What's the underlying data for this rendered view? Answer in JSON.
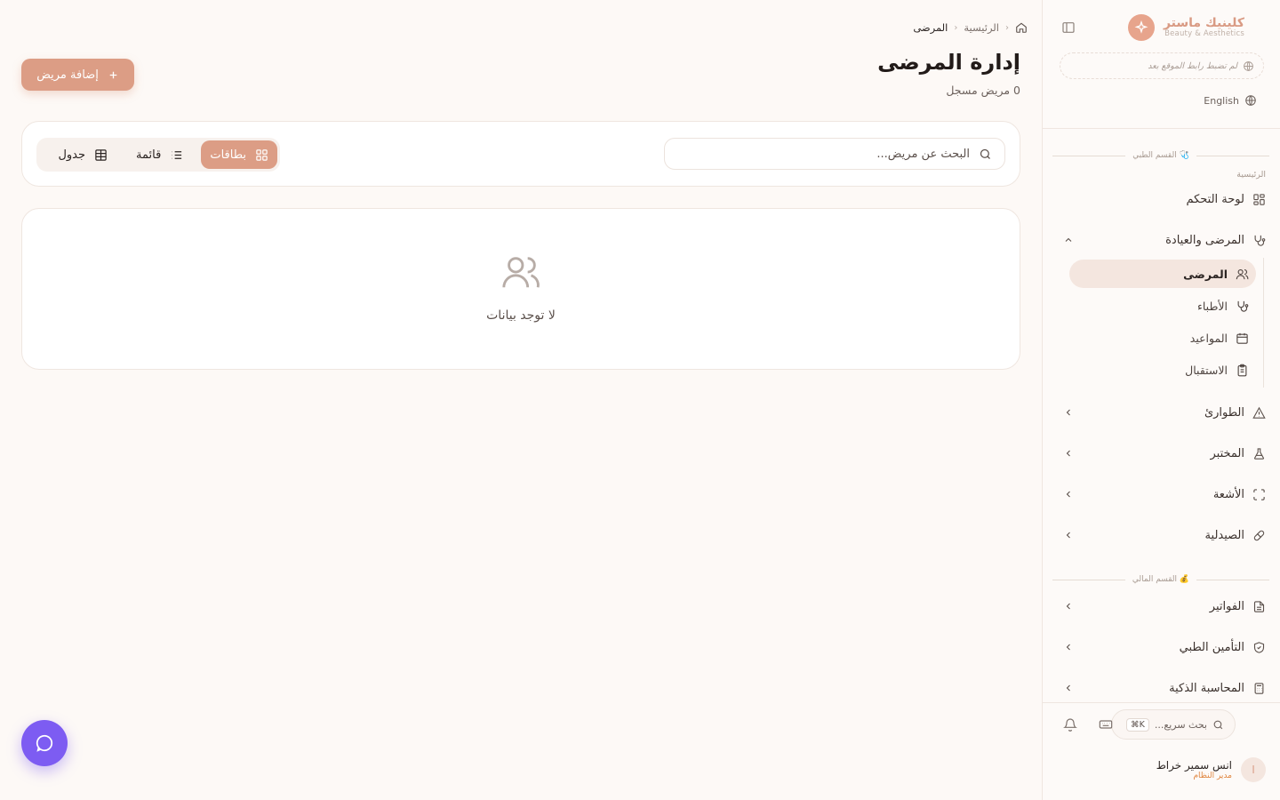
{
  "brand": {
    "name": "كلينيك ماستر",
    "subtitle": "Beauty & Aesthetics",
    "logo_icon": "sparkle-icon"
  },
  "sidebar": {
    "site_link_text": "لم تضبط رابط الموقع بعد",
    "language_label": "English",
    "medical_section_title": "🩺 القسم الطبي",
    "home_caption": "الرئيسية",
    "dashboard_label": "لوحة التحكم",
    "patients_group_label": "المرضى والعيادة",
    "sub_items": [
      {
        "label": "المرضى",
        "icon": "users-icon",
        "active": true
      },
      {
        "label": "الأطباء",
        "icon": "stethoscope-icon"
      },
      {
        "label": "المواعيد",
        "icon": "calendar-icon"
      },
      {
        "label": "الاستقبال",
        "icon": "clipboard-icon"
      }
    ],
    "groups": [
      {
        "label": "الطوارئ",
        "icon": "alert-triangle-icon"
      },
      {
        "label": "المختبر",
        "icon": "flask-icon"
      },
      {
        "label": "الأشعة",
        "icon": "scan-icon"
      },
      {
        "label": "الصيدلية",
        "icon": "pill-icon"
      }
    ],
    "finance_section_title": "💰 القسم المالي",
    "finance_groups": [
      {
        "label": "الفواتير",
        "icon": "file-text-icon"
      },
      {
        "label": "التأمين الطبي",
        "icon": "shield-check-icon"
      },
      {
        "label": "المحاسبة الذكية",
        "icon": "calculator-icon"
      }
    ],
    "quick_search_label": "بحث سريع...",
    "quick_search_shortcut": "⌘K",
    "user": {
      "initial": "ا",
      "name": "انس سمير خراط",
      "role": "مدير النظام"
    }
  },
  "main": {
    "breadcrumb": {
      "home": "الرئيسية",
      "current": "المرضى"
    },
    "title": "إدارة المرضى",
    "subtitle": "0 مريض مسجل",
    "add_button_label": "إضافة مريض",
    "search_placeholder": "البحث عن مريض...",
    "view_options": [
      {
        "label": "بطاقات",
        "icon": "grid-icon",
        "active": true
      },
      {
        "label": "قائمة",
        "icon": "list-icon"
      },
      {
        "label": "جدول",
        "icon": "table-icon"
      }
    ],
    "empty_text": "لا توجد بيانات"
  },
  "colors": {
    "accent": "#dc9d85",
    "chat_fab": "#7d5cf2",
    "background": "#fdf9f6"
  }
}
